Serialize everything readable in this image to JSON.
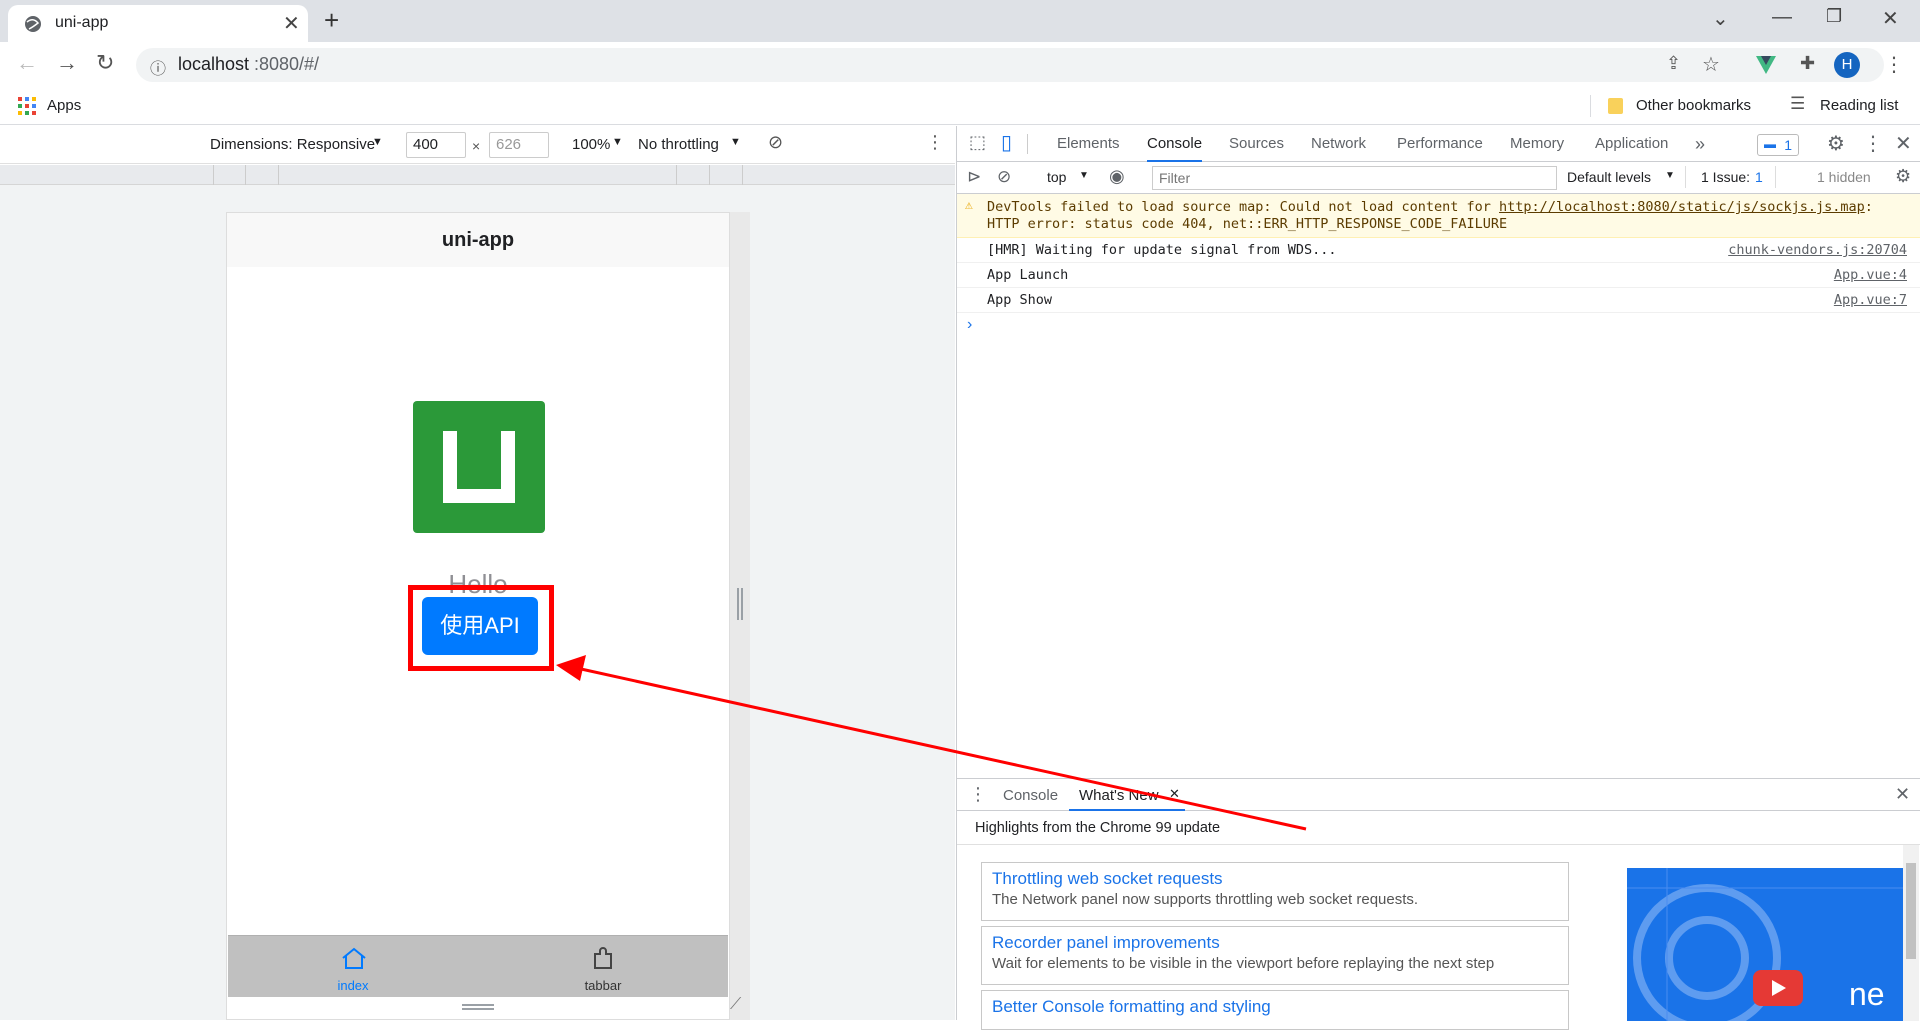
{
  "browser": {
    "tab_title": "uni-app",
    "new_tab": "+",
    "url_host": "localhost",
    "url_rest": ":8080/#/",
    "profile_initial": "H",
    "bookmarks": {
      "apps": "Apps",
      "other": "Other bookmarks",
      "reading": "Reading list"
    }
  },
  "device_toolbar": {
    "dimensions": "Dimensions: Responsive",
    "width": "400",
    "times": "×",
    "height_placeholder": "626",
    "zoom": "100%",
    "throttling": "No throttling"
  },
  "app": {
    "nav_title": "uni-app",
    "hello": "Hello",
    "api_button": "使用API",
    "tabs": [
      {
        "label": "index"
      },
      {
        "label": "tabbar"
      }
    ]
  },
  "devtools": {
    "tabs": [
      "Elements",
      "Console",
      "Sources",
      "Network",
      "Performance",
      "Memory",
      "Application"
    ],
    "more": "»",
    "issue_badge": "1",
    "console_toolbar": {
      "context": "top",
      "filter_placeholder": "Filter",
      "levels": "Default levels",
      "issues": "1 Issue:",
      "issues_count": "1",
      "hidden": "1 hidden"
    },
    "messages": [
      {
        "text1": "DevTools failed to load source map: Could not load content for ",
        "link": "http://localhost:8080/static/js/sockjs.js.map",
        "text2": ": HTTP error: status code 404, net::ERR_HTTP_RESPONSE_CODE_FAILURE"
      },
      {
        "text": "[HMR] Waiting for update signal from WDS...",
        "source": "chunk-vendors.js:20704"
      },
      {
        "text": "App Launch",
        "source": "App.vue:4"
      },
      {
        "text": "App Show",
        "source": "App.vue:7"
      }
    ],
    "prompt": "›",
    "drawer": {
      "tabs": [
        "Console",
        "What's New"
      ],
      "highlights": "Highlights from the Chrome 99 update",
      "cards": [
        {
          "title": "Throttling web socket requests",
          "desc": "The Network panel now supports throttling web socket requests."
        },
        {
          "title": "Recorder panel improvements",
          "desc": "Wait for elements to be visible in the viewport before replaying the next step"
        },
        {
          "title": "Better Console formatting and styling",
          "desc": ""
        }
      ],
      "video_text": "ne"
    }
  },
  "colors": {
    "accent": "#1a73e8",
    "annotation": "#ff0000",
    "button": "#007aff",
    "logo": "#2b9939",
    "warning_bg": "#fffbe5"
  }
}
